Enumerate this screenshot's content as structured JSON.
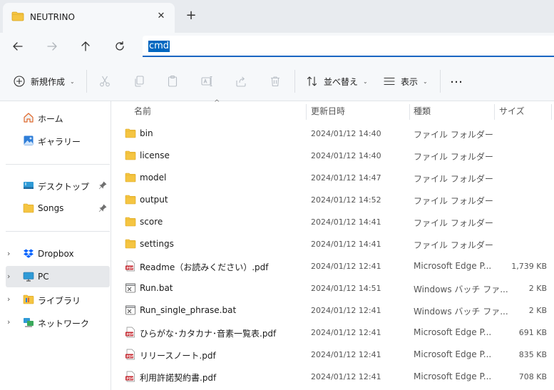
{
  "tab": {
    "title": "NEUTRINO",
    "close_glyph": "✕",
    "new_tab_glyph": "+"
  },
  "nav": {
    "back": "arrow-left-icon",
    "forward": "arrow-right-icon",
    "up": "arrow-up-icon",
    "refresh": "refresh-icon"
  },
  "address": {
    "value": "cmd"
  },
  "toolbar": {
    "new_label": "新規作成",
    "sort_label": "並べ替え",
    "view_label": "表示",
    "more_glyph": "…",
    "chevron": "⌄"
  },
  "sidebar": {
    "quick": [
      {
        "label": "ホーム",
        "icon": "home-icon"
      },
      {
        "label": "ギャラリー",
        "icon": "gallery-icon"
      }
    ],
    "pinned": [
      {
        "label": "デスクトップ",
        "icon": "desktop-icon"
      },
      {
        "label": "Songs",
        "icon": "folder-icon"
      }
    ],
    "tree": [
      {
        "label": "Dropbox",
        "icon": "dropbox-icon"
      },
      {
        "label": "PC",
        "icon": "pc-icon",
        "selected": true
      },
      {
        "label": "ライブラリ",
        "icon": "library-icon"
      },
      {
        "label": "ネットワーク",
        "icon": "network-icon"
      }
    ],
    "expand_glyph": "›"
  },
  "columns": {
    "name": "名前",
    "date": "更新日時",
    "type": "種類",
    "size": "サイズ",
    "sort_glyph": "^"
  },
  "files": [
    {
      "name": "bin",
      "date": "2024/01/12 14:40",
      "type": "ファイル フォルダー",
      "size": "",
      "icon": "folder-icon"
    },
    {
      "name": "license",
      "date": "2024/01/12 14:40",
      "type": "ファイル フォルダー",
      "size": "",
      "icon": "folder-icon"
    },
    {
      "name": "model",
      "date": "2024/01/12 14:47",
      "type": "ファイル フォルダー",
      "size": "",
      "icon": "folder-icon"
    },
    {
      "name": "output",
      "date": "2024/01/12 14:52",
      "type": "ファイル フォルダー",
      "size": "",
      "icon": "folder-icon"
    },
    {
      "name": "score",
      "date": "2024/01/12 14:41",
      "type": "ファイル フォルダー",
      "size": "",
      "icon": "folder-icon"
    },
    {
      "name": "settings",
      "date": "2024/01/12 14:41",
      "type": "ファイル フォルダー",
      "size": "",
      "icon": "folder-icon"
    },
    {
      "name": "Readme（お読みください）.pdf",
      "date": "2024/01/12 12:41",
      "type": "Microsoft Edge P...",
      "size": "1,739 KB",
      "icon": "pdf-icon"
    },
    {
      "name": "Run.bat",
      "date": "2024/01/12 14:51",
      "type": "Windows バッチ ファ...",
      "size": "2 KB",
      "icon": "batch-file-icon"
    },
    {
      "name": "Run_single_phrase.bat",
      "date": "2024/01/12 12:41",
      "type": "Windows バッチ ファ...",
      "size": "2 KB",
      "icon": "batch-file-icon"
    },
    {
      "name": "ひらがな･カタカナ･音素一覧表.pdf",
      "date": "2024/01/12 12:41",
      "type": "Microsoft Edge P...",
      "size": "691 KB",
      "icon": "pdf-icon"
    },
    {
      "name": "リリースノート.pdf",
      "date": "2024/01/12 12:41",
      "type": "Microsoft Edge P...",
      "size": "835 KB",
      "icon": "pdf-icon"
    },
    {
      "name": "利用許諾契約書.pdf",
      "date": "2024/01/12 12:41",
      "type": "Microsoft Edge P...",
      "size": "708 KB",
      "icon": "pdf-icon"
    }
  ],
  "colors": {
    "folder": "#f5c542",
    "accent": "#0067c0",
    "pdf": "#c4262e",
    "selected": "#e6e8eb"
  }
}
